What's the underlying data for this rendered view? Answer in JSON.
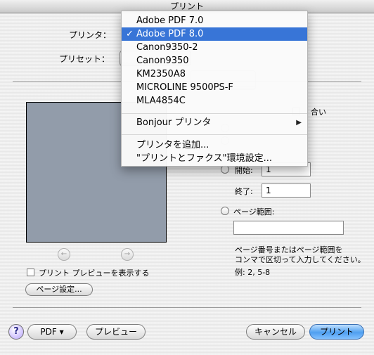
{
  "window": {
    "title": "プリント"
  },
  "printer": {
    "label": "プリンタ："
  },
  "preset": {
    "label": "プリセット："
  },
  "menu": {
    "items": [
      {
        "label": "Adobe PDF 7.0",
        "checked": false,
        "selected": false
      },
      {
        "label": "Adobe PDF 8.0",
        "checked": true,
        "selected": true
      },
      {
        "label": "Canon9350-2",
        "checked": false,
        "selected": false
      },
      {
        "label": "Canon9350",
        "checked": false,
        "selected": false
      },
      {
        "label": "KM2350A8",
        "checked": false,
        "selected": false
      },
      {
        "label": "MICROLINE 9500PS-F",
        "checked": false,
        "selected": false
      },
      {
        "label": "MLA4854C",
        "checked": false,
        "selected": false
      }
    ],
    "bonjour": "Bonjour プリンタ",
    "add_printer": "プリンタを追加...",
    "print_fax_prefs": "\"プリントとファクス\"環境設定...",
    "check_mark": "✓",
    "submenu_arrow": "▶"
  },
  "range": {
    "from_label": "開始:",
    "from_value": "1",
    "to_label": "終了:",
    "to_value": "1",
    "page_range_label": "ページ範囲:",
    "page_range_value": "",
    "help_line1": "ページ番号またはページ範囲を",
    "help_line2": "コンマで区切って入力してください。",
    "example": "例: 2, 5-8",
    "partial_collate": "合い"
  },
  "preview": {
    "show_preview_label": "プリント プレビューを表示する",
    "prev_icon": "←",
    "next_icon": "→"
  },
  "buttons": {
    "page_setup": "ページ設定...",
    "help": "?",
    "pdf": "PDF ▾",
    "preview": "プレビュー",
    "cancel": "キャンセル",
    "print": "プリント"
  }
}
